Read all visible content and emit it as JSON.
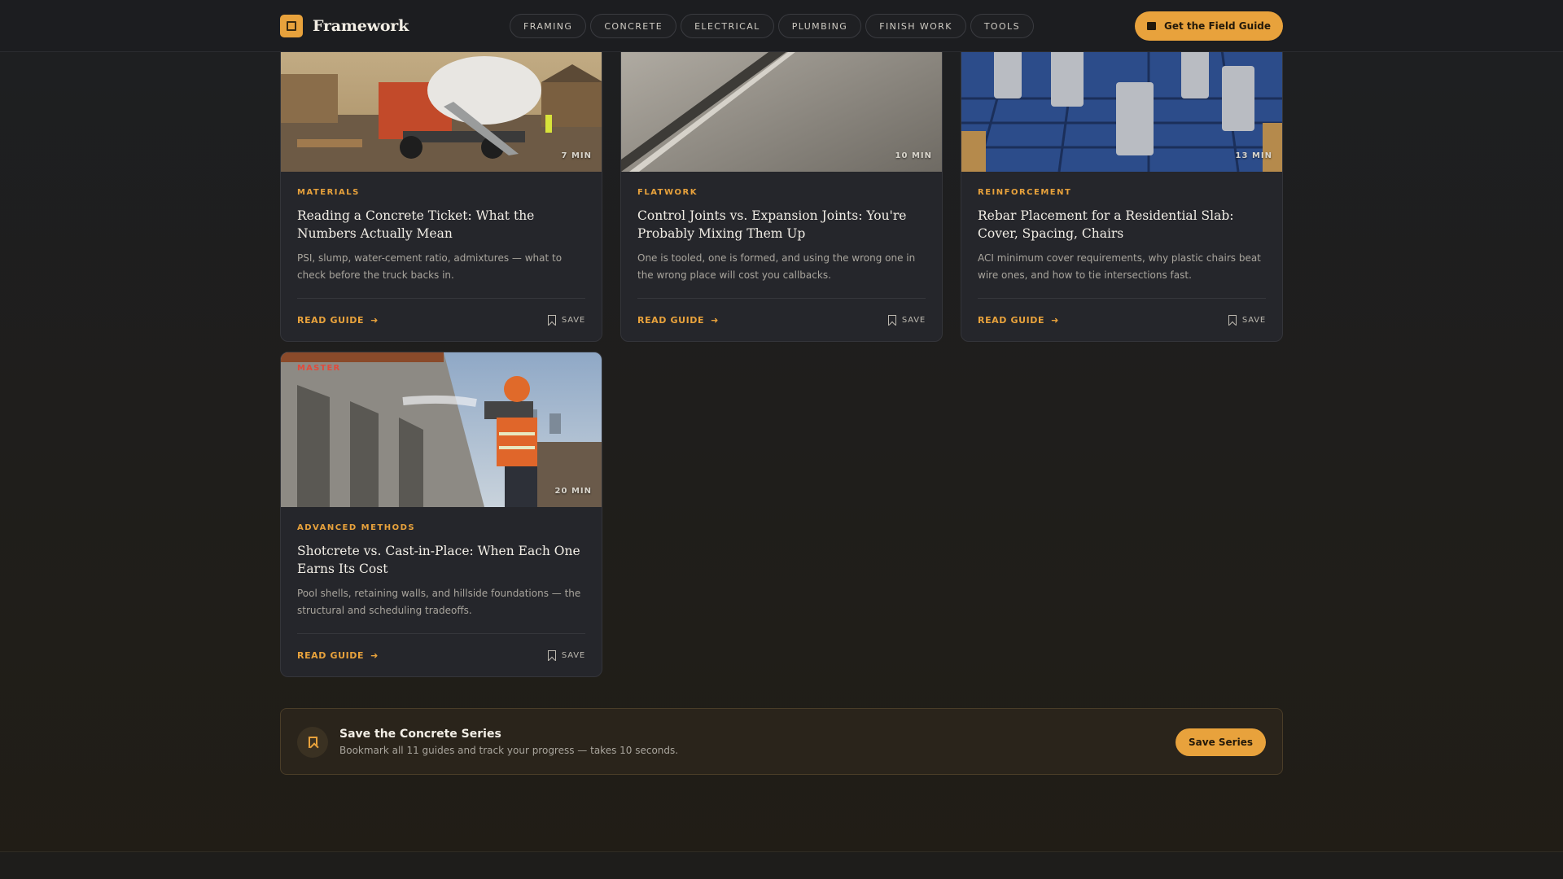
{
  "header": {
    "brand": "Framework",
    "nav": [
      "FRAMING",
      "CONCRETE",
      "ELECTRICAL",
      "PLUMBING",
      "FINISH WORK",
      "TOOLS"
    ],
    "cta_label": "Get the Field Guide"
  },
  "cards": [
    {
      "duration": "7 MIN",
      "category": "MATERIALS",
      "title": "Reading a Concrete Ticket: What the Numbers Actually Mean",
      "description": "PSI, slump, water-cement ratio, admixtures — what to check before the truck backs in.",
      "read_label": "READ GUIDE",
      "save_label": "SAVE"
    },
    {
      "duration": "10 MIN",
      "category": "FLATWORK",
      "title": "Control Joints vs. Expansion Joints: You're Probably Mixing Them Up",
      "description": "One is tooled, one is formed, and using the wrong one in the wrong place will cost you callbacks.",
      "read_label": "READ GUIDE",
      "save_label": "SAVE"
    },
    {
      "duration": "13 MIN",
      "category": "REINFORCEMENT",
      "title": "Rebar Placement for a Residential Slab: Cover, Spacing, Chairs",
      "description": "ACI minimum cover requirements, why plastic chairs beat wire ones, and how to tie intersections fast.",
      "read_label": "READ GUIDE",
      "save_label": "SAVE"
    },
    {
      "duration": "20 MIN",
      "badge": "MASTER",
      "category": "ADVANCED METHODS",
      "title": "Shotcrete vs. Cast-in-Place: When Each One Earns Its Cost",
      "description": "Pool shells, retaining walls, and hillside foundations — the structural and scheduling tradeoffs.",
      "read_label": "READ GUIDE",
      "save_label": "SAVE"
    }
  ],
  "banner": {
    "title": "Save the Concrete Series",
    "subtitle": "Bookmark all 11 guides and track your progress — takes 10 seconds.",
    "button": "Save Series"
  },
  "colors": {
    "accent": "#e8a23c",
    "card_bg": "#25262b",
    "badge_red": "#e24a3b"
  },
  "icons": [
    "brand-logo-icon",
    "book-icon",
    "arrow-right-icon",
    "bookmark-icon"
  ]
}
